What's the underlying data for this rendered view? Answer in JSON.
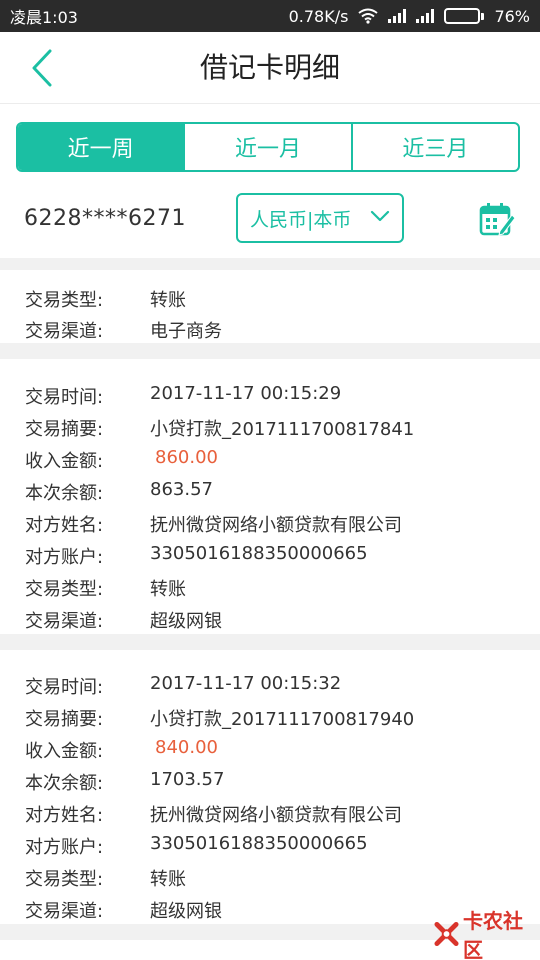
{
  "status_bar": {
    "time": "凌晨1:03",
    "network_speed": "0.78K/s",
    "battery_percent": "76%",
    "battery_level": 0.76,
    "icons": [
      "wifi-icon",
      "signal-icon",
      "signal-icon",
      "battery-icon"
    ]
  },
  "header": {
    "title": "借记卡明细",
    "back_icon": "chevron-left-icon"
  },
  "tabs": [
    {
      "label": "近一周",
      "active": true
    },
    {
      "label": "近一月",
      "active": false
    },
    {
      "label": "近三月",
      "active": false
    }
  ],
  "filter": {
    "card_number": "6228****6271",
    "currency_selected": "人民币|本币",
    "calendar_icon": "calendar-edit-icon"
  },
  "records": [
    {
      "fields": [
        {
          "key": "交易类型:",
          "value": "转账"
        },
        {
          "key": "交易渠道:",
          "value": "电子商务"
        }
      ]
    },
    {
      "fields": [
        {
          "key": "交易时间:",
          "value": "2017-11-17 00:15:29"
        },
        {
          "key": "交易摘要:",
          "value": "小贷打款_2017111700817841"
        },
        {
          "key": "收入金额:",
          "value": "860.00",
          "highlight": true
        },
        {
          "key": "本次余额:",
          "value": "863.57"
        },
        {
          "key": "对方姓名:",
          "value": "抚州微贷网络小额贷款有限公司"
        },
        {
          "key": "对方账户:",
          "value": "3305016188350000665"
        },
        {
          "key": "交易类型:",
          "value": "转账"
        },
        {
          "key": "交易渠道:",
          "value": "超级网银"
        }
      ]
    },
    {
      "fields": [
        {
          "key": "交易时间:",
          "value": "2017-11-17 00:15:32"
        },
        {
          "key": "交易摘要:",
          "value": "小贷打款_2017111700817940"
        },
        {
          "key": "收入金额:",
          "value": "840.00",
          "highlight": true
        },
        {
          "key": "本次余额:",
          "value": "1703.57"
        },
        {
          "key": "对方姓名:",
          "value": "抚州微贷网络小额贷款有限公司"
        },
        {
          "key": "对方账户:",
          "value": "3305016188350000665"
        },
        {
          "key": "交易类型:",
          "value": "转账"
        },
        {
          "key": "交易渠道:",
          "value": "超级网银"
        }
      ]
    }
  ],
  "watermark": {
    "text": "卡农社区"
  },
  "colors": {
    "accent": "#1bbfa3",
    "amount": "#e8603c",
    "divider": "#f1f1f1"
  }
}
